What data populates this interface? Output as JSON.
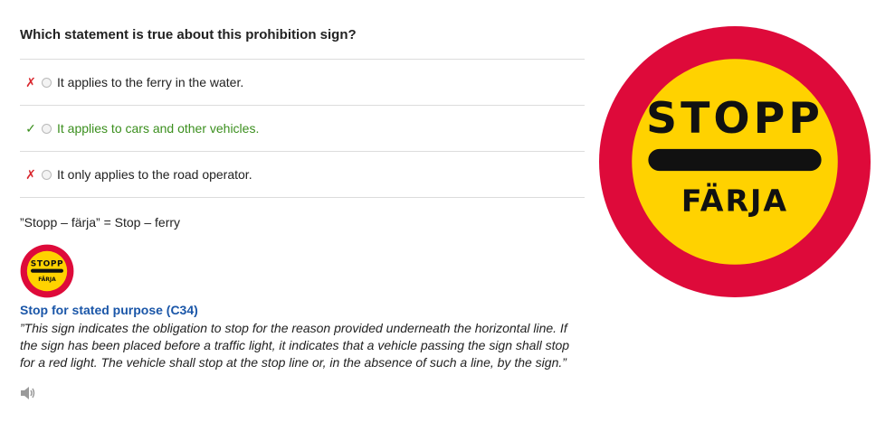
{
  "question": "Which statement is true about this prohibition sign?",
  "answers": [
    {
      "mark": "✗",
      "status": "wrong",
      "text": "It applies to the ferry in the water."
    },
    {
      "mark": "✓",
      "status": "correct",
      "text": "It applies to cars and other vehicles."
    },
    {
      "mark": "✗",
      "status": "wrong",
      "text": "It only applies to the road operator."
    }
  ],
  "explanation": "”Stopp – färja” = Stop – ferry",
  "sign": {
    "top_text": "STOPP",
    "bottom_text": "FÄRJA",
    "title": "Stop for stated purpose (C34)",
    "description": "”This sign indicates the obligation to stop for the reason provided underneath the horizontal line. If the sign has been placed before a traffic light, it indicates that a vehicle passing the sign shall stop for a red light. The vehicle shall stop at the stop line or, in the absence of such a line, by the sign.”",
    "colors": {
      "ring": "#de0a3a",
      "fill": "#ffd200",
      "text": "#111111"
    }
  },
  "icons": {
    "speaker": "speaker-icon"
  }
}
